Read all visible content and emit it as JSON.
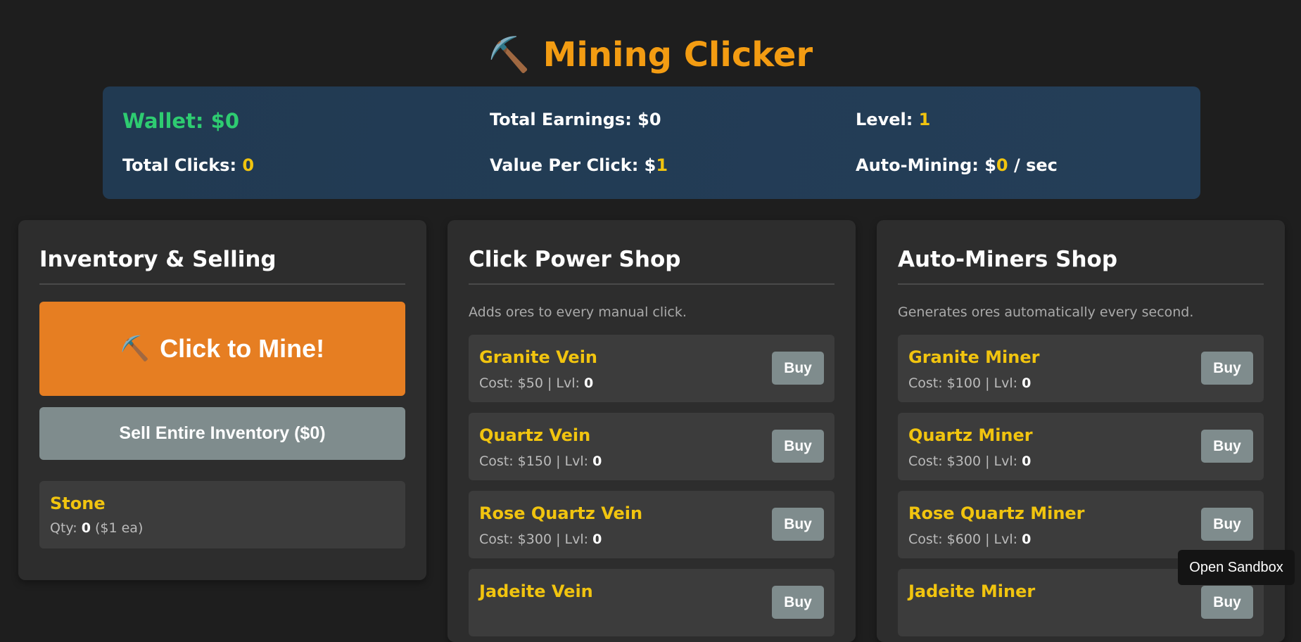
{
  "app": {
    "title": "Mining Clicker",
    "title_icon": "⛏️"
  },
  "stats": {
    "wallet_label": "Wallet: $",
    "wallet_value": "0",
    "total_earnings_label": "Total Earnings: $",
    "total_earnings_value": "0",
    "level_label": "Level: ",
    "level_value": "1",
    "total_clicks_label": "Total Clicks: ",
    "total_clicks_value": "0",
    "value_per_click_label": "Value Per Click: $",
    "value_per_click_value": "1",
    "auto_mining_label": "Auto-Mining: $",
    "auto_mining_value": "0",
    "auto_mining_suffix": " / sec"
  },
  "inventory": {
    "title": "Inventory & Selling",
    "mine_button_icon": "⛏️",
    "mine_button_label": "Click to Mine!",
    "sell_button_label": "Sell Entire Inventory ($0)",
    "items": [
      {
        "name": "Stone",
        "qty_label": "Qty: ",
        "qty": "0",
        "price_text": " ($1 ea)"
      }
    ]
  },
  "click_shop": {
    "title": "Click Power Shop",
    "description": "Adds ores to every manual click.",
    "items": [
      {
        "name": "Granite Vein",
        "cost_text": "Cost: $50 | Lvl: ",
        "level": "0",
        "buy_label": "Buy"
      },
      {
        "name": "Quartz Vein",
        "cost_text": "Cost: $150 | Lvl: ",
        "level": "0",
        "buy_label": "Buy"
      },
      {
        "name": "Rose Quartz Vein",
        "cost_text": "Cost: $300 | Lvl: ",
        "level": "0",
        "buy_label": "Buy"
      },
      {
        "name": "Jadeite Vein",
        "cost_text": "",
        "level": "",
        "buy_label": "Buy"
      }
    ]
  },
  "auto_shop": {
    "title": "Auto-Miners Shop",
    "description": "Generates ores automatically every second.",
    "items": [
      {
        "name": "Granite Miner",
        "cost_text": "Cost: $100 | Lvl: ",
        "level": "0",
        "buy_label": "Buy"
      },
      {
        "name": "Quartz Miner",
        "cost_text": "Cost: $300 | Lvl: ",
        "level": "0",
        "buy_label": "Buy"
      },
      {
        "name": "Rose Quartz Miner",
        "cost_text": "Cost: $600 | Lvl: ",
        "level": "0",
        "buy_label": "Buy"
      },
      {
        "name": "Jadeite Miner",
        "cost_text": "",
        "level": "",
        "buy_label": "Buy"
      }
    ]
  },
  "sandbox_button_label": "Open Sandbox",
  "colors": {
    "accent_orange": "#f39c12",
    "mine_button": "#e67e22",
    "wallet_green": "#2ecc71",
    "highlight_yellow": "#f1c40f",
    "button_gray": "#7f8c8d",
    "stats_bg": "#223b54"
  }
}
